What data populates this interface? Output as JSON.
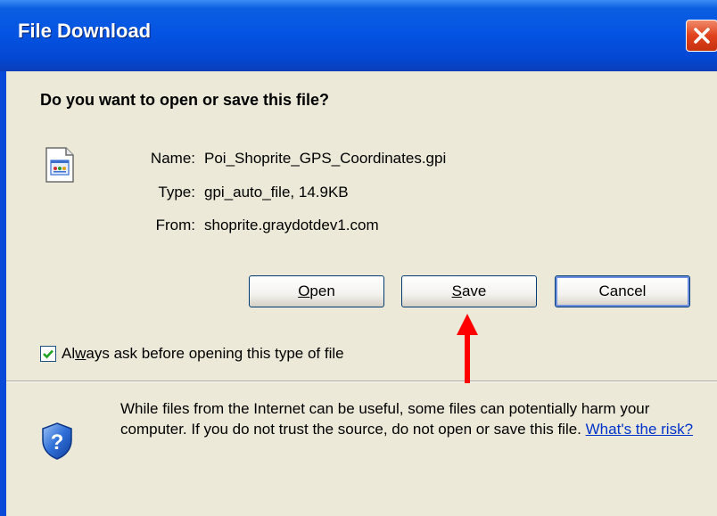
{
  "window": {
    "title": "File Download"
  },
  "dialog": {
    "question": "Do you want to open or save this file?",
    "file": {
      "name_label": "Name:",
      "name_value": "Poi_Shoprite_GPS_Coordinates.gpi",
      "type_label": "Type:",
      "type_value": "gpi_auto_file, 14.9KB",
      "from_label": "From:",
      "from_value": "shoprite.graydotdev1.com"
    },
    "buttons": {
      "open_mnemonic": "O",
      "open_rest": "pen",
      "save_mnemonic": "S",
      "save_rest": "ave",
      "cancel": "Cancel"
    },
    "checkbox": {
      "label_pre": "Al",
      "label_mnemonic": "w",
      "label_post": "ays ask before opening this type of file",
      "checked": true
    },
    "warning": {
      "text": "While files from the Internet can be useful, some files can potentially harm your computer. If you do not trust the source, do not open or save this file. ",
      "link": "What's the risk?"
    }
  },
  "annotation": {
    "arrow_color": "#ff0000",
    "points_to": "save-button"
  },
  "icons": {
    "close": "close-icon",
    "file": "file-icon",
    "security": "shield-question-icon"
  }
}
